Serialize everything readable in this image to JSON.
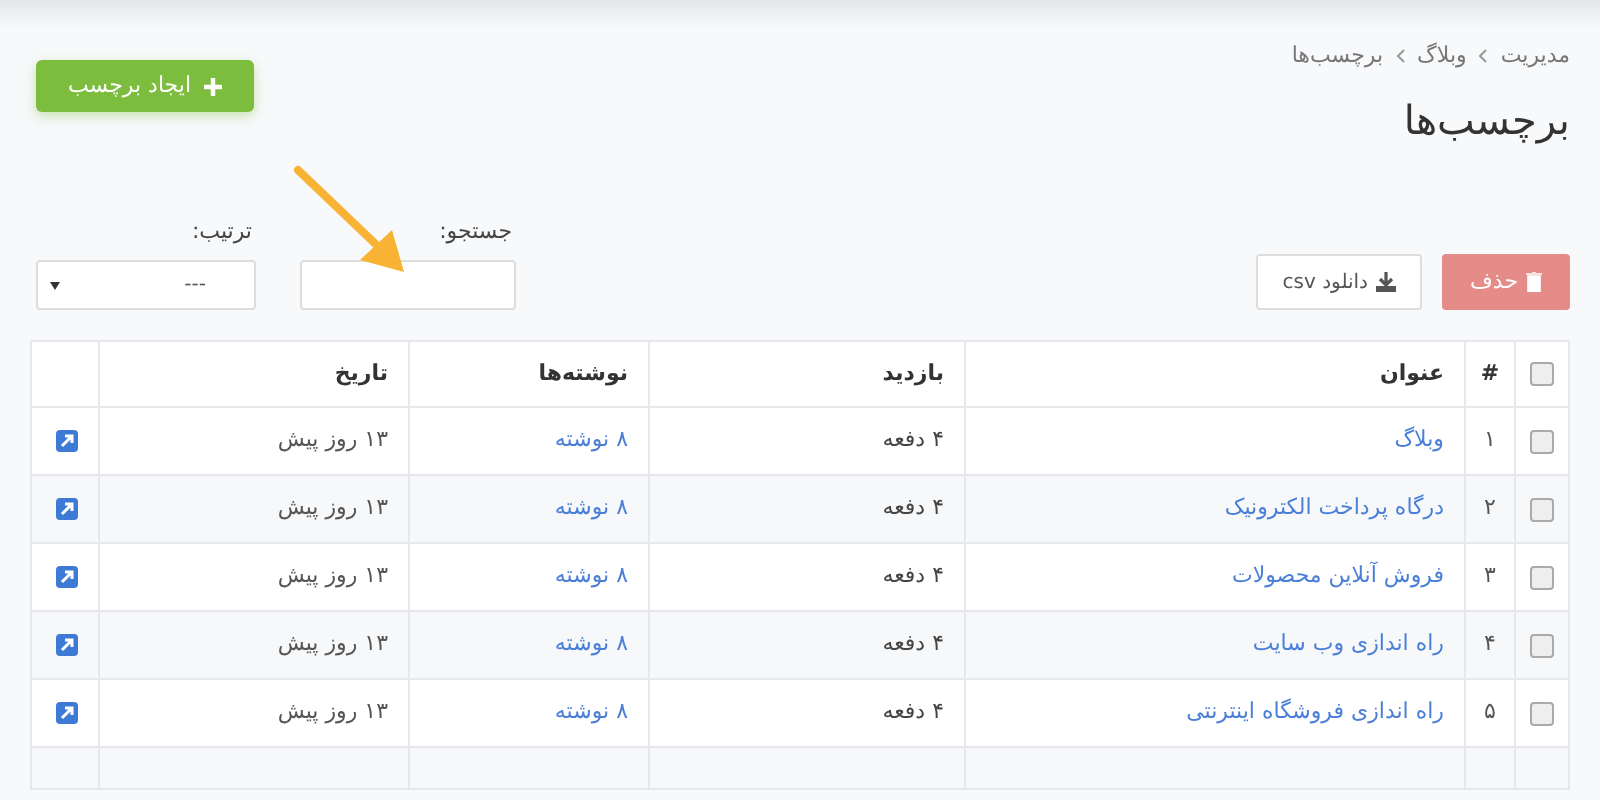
{
  "breadcrumb": [
    "مدیریت",
    "وبلاگ",
    "برچسب‌ها"
  ],
  "title": "برچسب‌ها",
  "create_button": "ایجاد برچسب",
  "delete_button": "حذف",
  "csv_button": "دانلود csv",
  "search": {
    "label": "جستجو:"
  },
  "sort": {
    "label": "ترتیب:",
    "value": "---"
  },
  "table": {
    "select_all_checked": false,
    "columns": [
      "#",
      "عنوان",
      "بازدید",
      "نوشته‌ها",
      "تاریخ"
    ],
    "rows": [
      {
        "checked": false,
        "index": "۱",
        "title": "وبلاگ",
        "visits": "۴ دفعه",
        "posts": "۸ نوشته",
        "date": "۱۳ روز پیش"
      },
      {
        "checked": false,
        "index": "۲",
        "title": "درگاه پرداخت الکترونیک",
        "visits": "۴ دفعه",
        "posts": "۸ نوشته",
        "date": "۱۳ روز پیش"
      },
      {
        "checked": false,
        "index": "۳",
        "title": "فروش آنلاین محصولات",
        "visits": "۴ دفعه",
        "posts": "۸ نوشته",
        "date": "۱۳ روز پیش"
      },
      {
        "checked": false,
        "index": "۴",
        "title": "راه اندازی وب سایت",
        "visits": "۴ دفعه",
        "posts": "۸ نوشته",
        "date": "۱۳ روز پیش"
      },
      {
        "checked": false,
        "index": "۵",
        "title": "راه اندازی فروشگاه اینترنتی",
        "visits": "۴ دفعه",
        "posts": "۸ نوشته",
        "date": "۱۳ روز پیش"
      }
    ]
  }
}
